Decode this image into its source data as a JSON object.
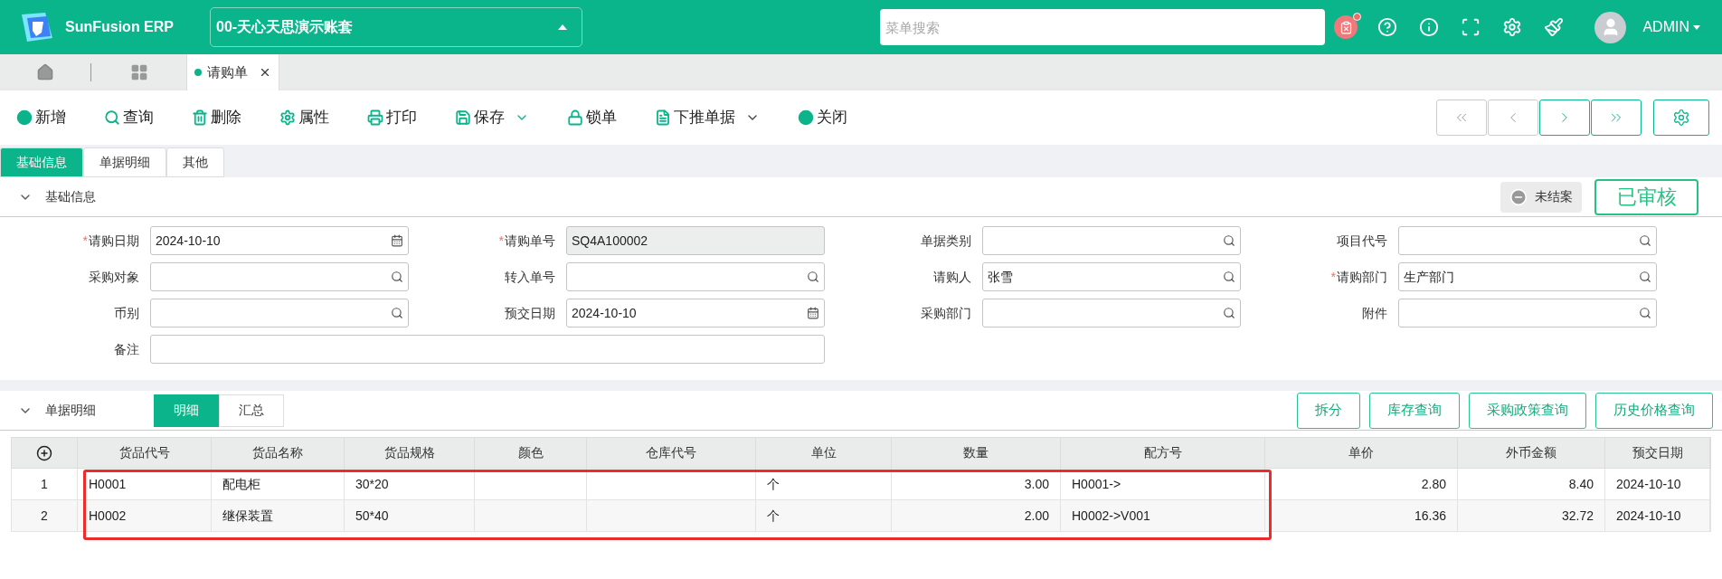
{
  "header": {
    "logo_text": "SunFusion ERP",
    "account": "00-天心天思演示账套",
    "search": {
      "placeholder": "菜单搜索"
    },
    "notification": true,
    "user": "ADMIN"
  },
  "page_tabs": [
    {
      "label": "请购单",
      "selected": true
    }
  ],
  "toolbar": [
    {
      "label": "新增",
      "dropdown": false
    },
    {
      "label": "查询",
      "dropdown": false
    },
    {
      "label": "删除",
      "dropdown": false
    },
    {
      "label": "属性",
      "dropdown": false
    },
    {
      "label": "打印",
      "dropdown": false
    },
    {
      "label": "保存",
      "dropdown": true
    },
    {
      "label": "锁单",
      "dropdown": false
    },
    {
      "label": "下推单据",
      "dropdown": true
    },
    {
      "label": "关闭",
      "dropdown": false
    }
  ],
  "record_nav": [
    {
      "disabled": true
    },
    {
      "disabled": true
    },
    {
      "disabled": false
    },
    {
      "disabled": false
    }
  ],
  "form_tabs": [
    {
      "label": "基础信息",
      "selected": true
    },
    {
      "label": "单据明细",
      "selected": false
    },
    {
      "label": "其他",
      "selected": false
    }
  ],
  "basic_section": {
    "title": "基础信息",
    "required_marker": "*",
    "expanded": true,
    "closed_status": "未结案",
    "approval_stamp": "已审核",
    "fields": [
      {
        "label": "请购日期",
        "required": true,
        "value": "2024-10-10",
        "kind": "date"
      },
      {
        "label": "请购单号",
        "required": true,
        "value": "SQ4A100002",
        "kind": "readonly"
      },
      {
        "label": "单据类别",
        "required": false,
        "kind": "lookup"
      },
      {
        "label": "项目代号",
        "required": false,
        "kind": "lookup"
      },
      {
        "label": "采购对象",
        "required": false,
        "kind": "lookup"
      },
      {
        "label": "转入单号",
        "required": false,
        "kind": "lookup"
      },
      {
        "label": "请购人",
        "required": false,
        "value": "张雪",
        "kind": "lookup"
      },
      {
        "label": "请购部门",
        "required": true,
        "value": "生产部门",
        "kind": "lookup"
      },
      {
        "label": "币别",
        "required": false,
        "kind": "lookup"
      },
      {
        "label": "预交日期",
        "required": false,
        "value": "2024-10-10",
        "kind": "date"
      },
      {
        "label": "采购部门",
        "required": false,
        "kind": "lookup"
      },
      {
        "label": "附件",
        "required": false,
        "kind": "lookup"
      },
      {
        "label": "备注",
        "required": false,
        "kind": "wide"
      }
    ]
  },
  "detail_section": {
    "title": "单据明细",
    "expanded": true,
    "views": [
      {
        "label": "明细",
        "selected": true
      },
      {
        "label": "汇总",
        "selected": false
      }
    ],
    "actions": [
      "拆分",
      "库存查询",
      "采购政策查询",
      "历史价格查询"
    ],
    "table": {
      "columns": [
        {
          "label": "货品代号",
          "kind": "text"
        },
        {
          "label": "货品名称",
          "kind": "text"
        },
        {
          "label": "货品规格",
          "kind": "text"
        },
        {
          "label": "颜色",
          "kind": "text"
        },
        {
          "label": "仓库代号",
          "kind": "text"
        },
        {
          "label": "单位",
          "kind": "text"
        },
        {
          "label": "数量",
          "kind": "number"
        },
        {
          "label": "配方号",
          "kind": "text"
        },
        {
          "label": "单价",
          "kind": "number"
        },
        {
          "label": "外币金额",
          "kind": "number"
        },
        {
          "label": "预交日期",
          "kind": "text"
        }
      ],
      "rows": [
        {
          "index": "1",
          "cells": [
            "H0001",
            "配电柜",
            "30*20",
            "",
            "",
            "个",
            "3.00",
            "H0001->",
            "2.80",
            "8.40",
            "2024-10-10"
          ]
        },
        {
          "index": "2",
          "cells": [
            "H0002",
            "继保装置",
            "50*40",
            "",
            "",
            "个",
            "2.00",
            "H0002->V001",
            "16.36",
            "32.72",
            "2024-10-10"
          ]
        }
      ]
    }
  }
}
